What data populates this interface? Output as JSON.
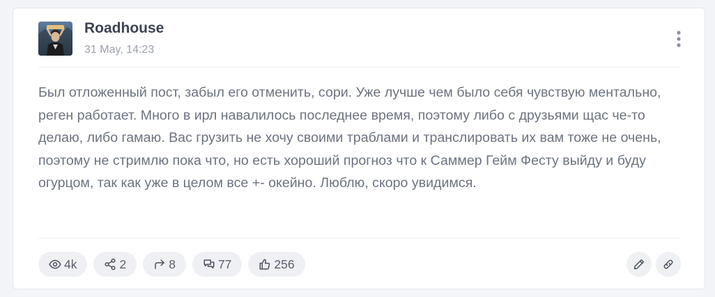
{
  "post": {
    "author": "Roadhouse",
    "date": "31 May, 14:23",
    "text": "Был отложенный пост, забыл его отменить, сори. Уже лучше чем было себя чувствую ментально, реген работает. Много в ирл навалилось последнее время, поэтому либо с друзьями щас че-то делаю, либо гамаю. Вас грузить не хочу своими траблами и транслировать их вам тоже не очень, поэтому не стримлю пока что, но есть хороший прогноз что к Саммер Гейм Фесту выйду и буду огурцом, так как уже в целом все +- окейно. Люблю, скоро увидимся."
  },
  "stats": {
    "views": "4k",
    "shares": "2",
    "reposts": "8",
    "comments": "77",
    "likes": "256"
  },
  "icons": {
    "views": "eye-icon",
    "shares": "share-icon",
    "reposts": "repost-arrow-icon",
    "comments": "comments-icon",
    "likes": "thumbs-up-icon",
    "edit": "pencil-icon",
    "link": "link-icon",
    "menu": "more-vertical-icon"
  },
  "colors": {
    "background": "#f3f4f7",
    "card": "#ffffff",
    "text": "#6c7380",
    "author": "#3d4351",
    "muted": "#9aa0ab",
    "pill": "#eef0f4"
  }
}
